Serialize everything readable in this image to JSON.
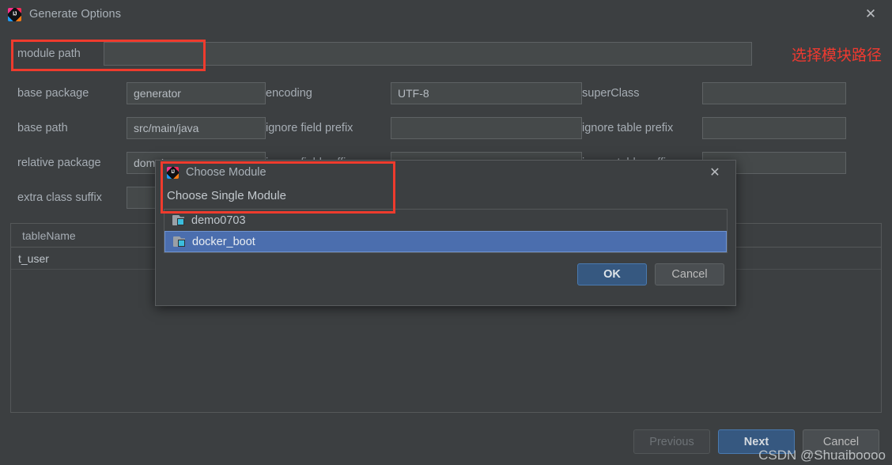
{
  "window": {
    "title": "Generate Options",
    "icon": "intellij-idea-icon",
    "close_label": "✕"
  },
  "annotations": {
    "module_path_note": "选择模块路径",
    "highlight_color": "#ef3b2d"
  },
  "form": {
    "module_path": {
      "label": "module path",
      "value": "",
      "placeholder": ""
    },
    "rows": [
      {
        "left": {
          "label": "base package",
          "value": "generator"
        },
        "middle": {
          "label": "encoding",
          "value": "UTF-8"
        },
        "right": {
          "label": "superClass",
          "value": ""
        }
      },
      {
        "left": {
          "label": "base path",
          "value": "src/main/java"
        },
        "middle": {
          "label": "ignore field prefix",
          "value": ""
        },
        "right": {
          "label": "ignore table prefix",
          "value": ""
        }
      },
      {
        "left": {
          "label": "relative package",
          "value": "domain"
        },
        "middle": {
          "label": "ignore field suffix",
          "value": ""
        },
        "right": {
          "label": "ignore table suffix",
          "value": ""
        }
      },
      {
        "left": {
          "label": "extra class suffix",
          "value": ""
        },
        "middle": {
          "label": "",
          "value": ""
        },
        "right": {
          "label": "",
          "value": ""
        }
      }
    ]
  },
  "table": {
    "columns": [
      "tableName",
      "",
      ""
    ],
    "rows": [
      {
        "tableName": "t_user",
        "col2": "",
        "col3": ""
      }
    ]
  },
  "footer": {
    "previous_label": "Previous",
    "next_label": "Next",
    "cancel_label": "Cancel"
  },
  "modal": {
    "title": "Choose Module",
    "icon": "intellij-idea-icon",
    "close_label": "✕",
    "subtitle": "Choose Single Module",
    "modules": [
      {
        "name": "demo0703",
        "selected": false,
        "icon": "module-folder-icon"
      },
      {
        "name": "docker_boot",
        "selected": true,
        "icon": "module-folder-icon"
      }
    ],
    "ok_label": "OK",
    "cancel_label": "Cancel",
    "selection_color": "#4b6eae"
  },
  "watermark": {
    "text": "CSDN @Shuaiboooo"
  }
}
